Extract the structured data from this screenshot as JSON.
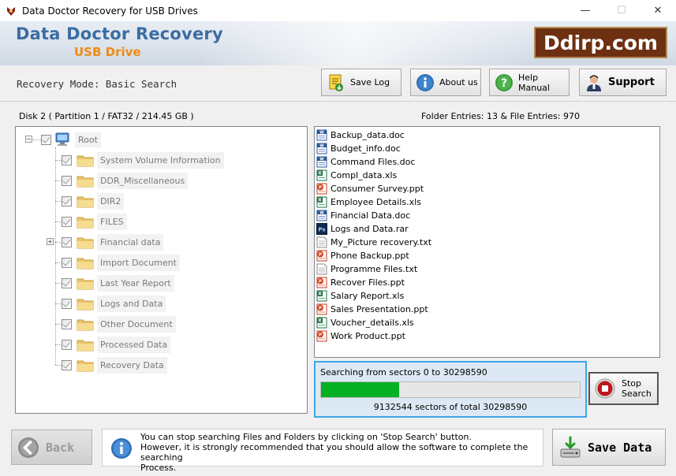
{
  "window": {
    "title": "Data Doctor Recovery for USB Drives",
    "minimize": "—",
    "maximize": "☐",
    "close": "✕"
  },
  "banner": {
    "title": "Data Doctor Recovery",
    "subtitle": "USB Drive",
    "logo": "Ddirp.com"
  },
  "toolbar": {
    "mode": "Recovery Mode: Basic Search",
    "save_log": "Save Log",
    "about": "About us",
    "help": "Help Manual",
    "support": "Support"
  },
  "disk_info": "Disk 2 ( Partition 1 / FAT32 / 214.45 GB )",
  "entries_info": "Folder Entries: 13 & File Entries: 970",
  "tree": {
    "root": "Root",
    "folders": [
      "System Volume Information",
      "DDR_Miscellaneous",
      "DIR2",
      "FILES",
      "Financial data",
      "Import Document",
      "Last Year Report",
      "Logs and Data",
      "Other Document",
      "Processed Data",
      "Recovery Data"
    ],
    "expander_collapse": "−",
    "expander_expand": "+"
  },
  "files": [
    {
      "name": "Backup_data.doc",
      "type": "doc"
    },
    {
      "name": "Budget_info.doc",
      "type": "doc"
    },
    {
      "name": "Command Files.doc",
      "type": "doc"
    },
    {
      "name": "Compl_data.xls",
      "type": "xls"
    },
    {
      "name": "Consumer Survey.ppt",
      "type": "ppt"
    },
    {
      "name": "Employee Details.xls",
      "type": "xls"
    },
    {
      "name": "Financial Data.doc",
      "type": "doc"
    },
    {
      "name": "Logs and Data.rar",
      "type": "rar"
    },
    {
      "name": "My_Picture recovery.txt",
      "type": "txt"
    },
    {
      "name": "Phone Backup.ppt",
      "type": "ppt"
    },
    {
      "name": "Programme Files.txt",
      "type": "txt"
    },
    {
      "name": "Recover Files.ppt",
      "type": "ppt"
    },
    {
      "name": "Salary Report.xls",
      "type": "xls"
    },
    {
      "name": "Sales Presentation.ppt",
      "type": "ppt"
    },
    {
      "name": "Voucher_details.xls",
      "type": "xls"
    },
    {
      "name": "Work Product.ppt",
      "type": "ppt"
    }
  ],
  "progress": {
    "text": "Searching from sectors   0 to 30298590",
    "count_text": "9132544   sectors  of  total 30298590",
    "current": 9132544,
    "total": 30298590
  },
  "stop_button": {
    "line1": "Stop",
    "line2": "Search"
  },
  "bottom": {
    "back": "Back",
    "message_line1": "You can stop searching Files and Folders by clicking on 'Stop Search' button.",
    "message_line2": "However, it is strongly recommended that you should allow the software to complete the searching",
    "message_line3": "Process.",
    "save": "Save Data"
  },
  "colors": {
    "brand_blue": "#3b6da3",
    "brand_orange": "#f08a12",
    "logo_bg": "#6d3011",
    "progress_fill": "#06b025",
    "progress_border": "#3ea6e6"
  }
}
